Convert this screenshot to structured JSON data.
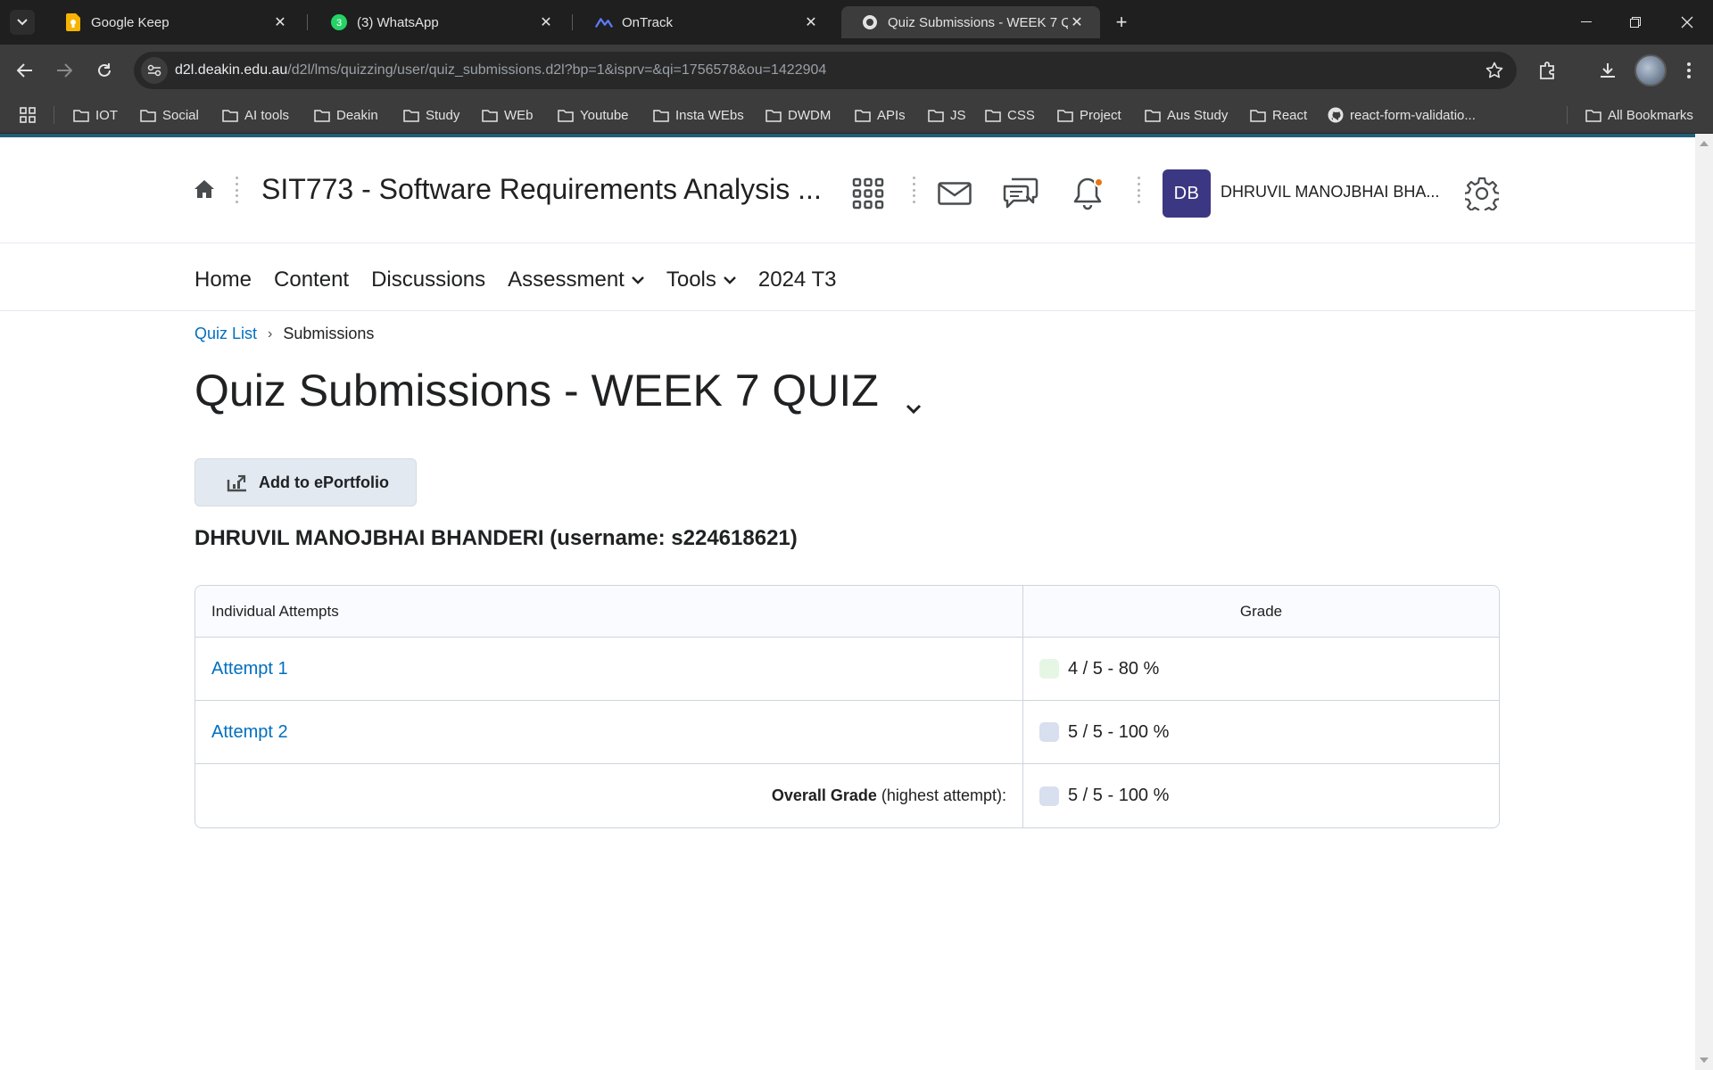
{
  "browser": {
    "tabs": [
      {
        "title": "Google Keep",
        "favicon": "google-keep-icon",
        "active": false
      },
      {
        "title": "(3) WhatsApp",
        "favicon": "whatsapp-icon",
        "active": false
      },
      {
        "title": "OnTrack",
        "favicon": "ontrack-icon",
        "active": false
      },
      {
        "title": "Quiz Submissions - WEEK 7 QUIZ",
        "favicon": "d2l-icon",
        "active": true
      }
    ],
    "url_host": "d2l.deakin.edu.au",
    "url_path": "/d2l/lms/quizzing/user/quiz_submissions.d2l?bp=1&isprv=&qi=1756578&ou=1422904",
    "bookmarks": [
      "IOT",
      "Social",
      "AI tools",
      "Deakin",
      "Study",
      "WEb",
      "Youtube",
      "Insta WEbs",
      "DWDM",
      "APIs",
      "JS",
      "CSS",
      "Project",
      "Aus Study",
      "React",
      "react-form-validatio..."
    ],
    "all_bookmarks": "All Bookmarks"
  },
  "header": {
    "course_title": "SIT773 - Software Requirements Analysis ...",
    "avatar_initials": "DB",
    "user_name": "DHRUVIL MANOJBHAI BHA..."
  },
  "course_nav": {
    "items": [
      "Home",
      "Content",
      "Discussions",
      "Assessment",
      "Tools",
      "2024 T3"
    ]
  },
  "breadcrumb": {
    "link": "Quiz List",
    "separator": "›",
    "current": "Submissions"
  },
  "page": {
    "title": "Quiz Submissions - WEEK 7 QUIZ",
    "add_button": "Add to ePortfolio",
    "student_line": "DHRUVIL MANOJBHAI BHANDERI (username: s224618621)"
  },
  "table": {
    "col_attempts": "Individual Attempts",
    "col_grade": "Grade",
    "rows": [
      {
        "attempt": "Attempt 1",
        "grade": "4 / 5 - 80 %",
        "swatch": "#e6f6e4"
      },
      {
        "attempt": "Attempt 2",
        "grade": "5 / 5 - 100 %",
        "swatch": "#d8dfee"
      }
    ],
    "overall_label_bold": "Overall Grade",
    "overall_label_rest": " (highest attempt):",
    "overall_grade": "5 / 5 - 100 %",
    "overall_swatch": "#d8dfee"
  },
  "colors": {
    "link": "#006fbf",
    "accent_bar": "#1f5f78",
    "avatar_bg": "#3c3782",
    "notification_dot": "#e87511"
  }
}
